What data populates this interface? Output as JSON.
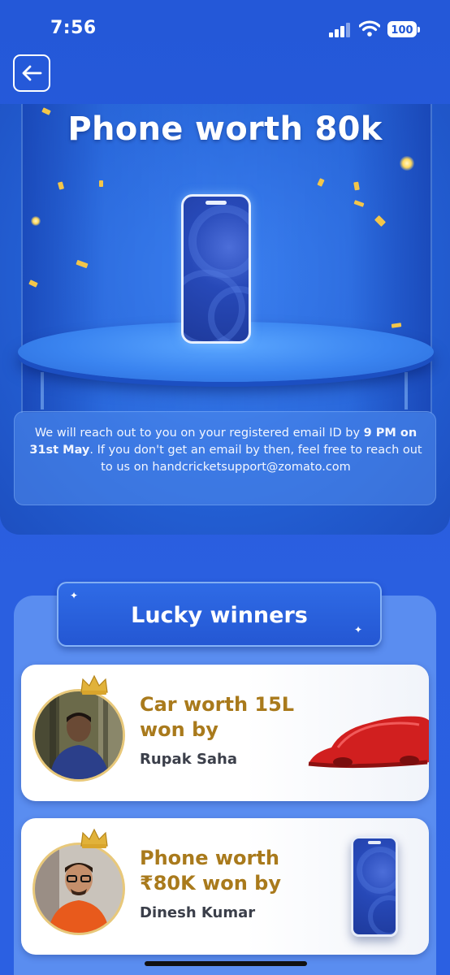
{
  "status_bar": {
    "time": "7:56",
    "battery": "100"
  },
  "hero": {
    "title": "Phone worth 80k",
    "info_line1": "We will reach out to you on your registered email ID by",
    "info_bold": "9 PM on 31st May",
    "info_line2": ". If you don't get an email by then, feel free to reach out to us on",
    "info_email": "handcricketsupport@zomato.com"
  },
  "winners": {
    "title": "Lucky winners",
    "items": [
      {
        "prize_line1": "Car worth 15L",
        "prize_line2": "won by",
        "name": "Rupak Saha"
      },
      {
        "prize_line1": "Phone worth",
        "prize_line2": "₹80K won by",
        "name": "Dinesh Kumar"
      }
    ]
  },
  "colors": {
    "primary_blue": "#2458d8",
    "prize_gold": "#a97a1c",
    "car_red": "#d42020"
  },
  "icons": [
    "back-arrow-icon",
    "signal-icon",
    "wifi-icon",
    "battery-icon",
    "crown-icon",
    "sparkle-icon"
  ]
}
